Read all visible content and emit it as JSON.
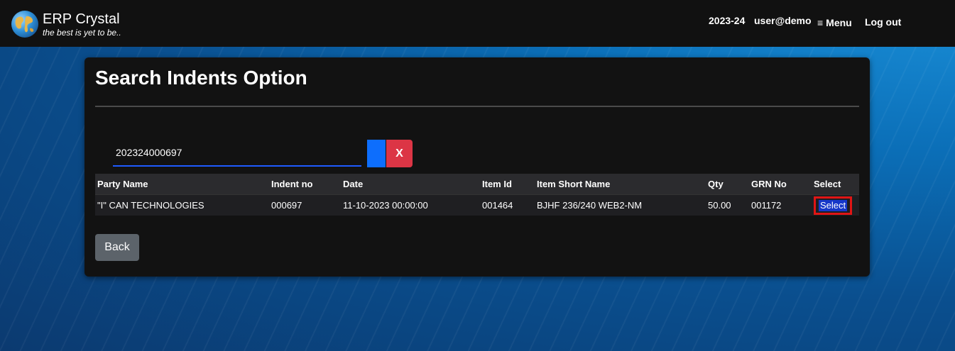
{
  "navbar": {
    "brand_title": "ERP Crystal",
    "brand_tagline": "the best is yet to be..",
    "financial_year": "2023-24",
    "user": "user@demo",
    "menu_glyph": "≡",
    "menu_label": "Menu",
    "logout_label": "Log out",
    "logo_icon": "globe-icon"
  },
  "page": {
    "title": "Search Indents Option"
  },
  "search": {
    "value": "202324000697",
    "clear_label": "X"
  },
  "table": {
    "headers": [
      "Party Name",
      "Indent no",
      "Date",
      "Item Id",
      "Item Short Name",
      "Qty",
      "GRN No",
      "Select"
    ],
    "rows": [
      {
        "party_name": "\"I\" CAN TECHNOLOGIES",
        "indent_no": "000697",
        "date": "11-10-2023 00:00:00",
        "item_id": "001464",
        "item_short_name": "BJHF 236/240 WEB2-NM",
        "qty": "50.00",
        "grn_no": "001172",
        "select_label": "Select"
      }
    ]
  },
  "actions": {
    "back_label": "Back"
  },
  "colors": {
    "primary": "#0d6efd",
    "danger": "#dc3545",
    "secondary": "#5c636a",
    "highlight_border": "#e01515"
  }
}
